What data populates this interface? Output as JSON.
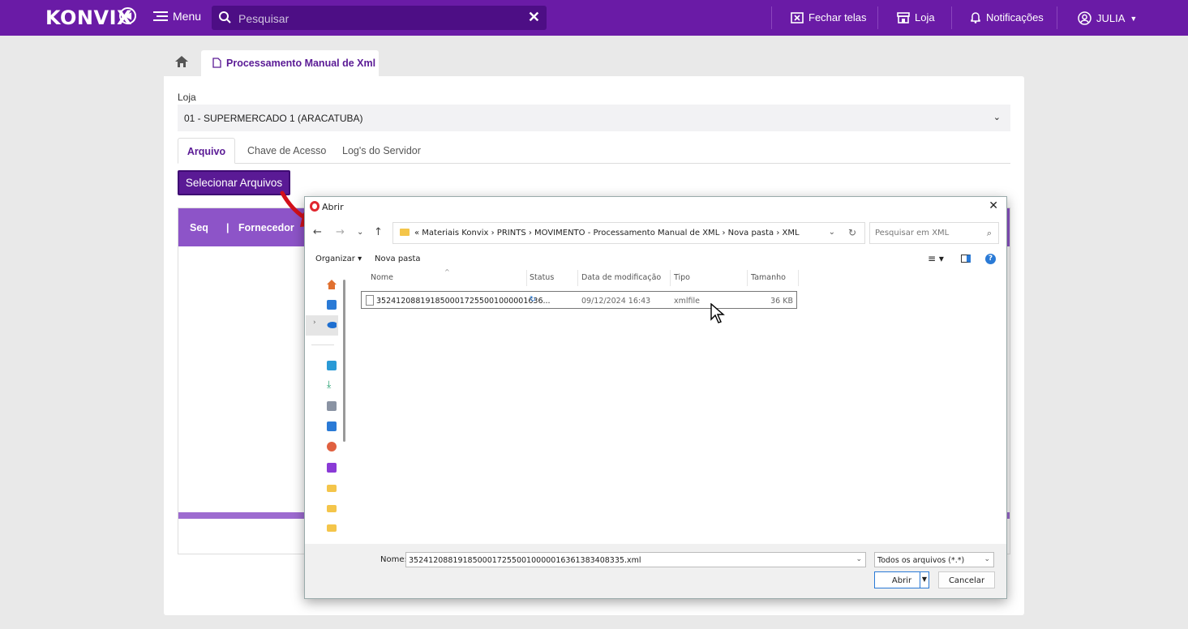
{
  "topbar": {
    "logo": "KONVIX",
    "menu_label": "Menu",
    "search_placeholder": "Pesquisar",
    "close_screens": "Fechar telas",
    "store": "Loja",
    "notifications": "Notificações",
    "user": "JULIA"
  },
  "page": {
    "tab_title": "Processamento Manual de Xml",
    "loja_label": "Loja",
    "loja_value": "01 - SUPERMERCADO 1 (ARACATUBA)",
    "tabs": [
      "Arquivo",
      "Chave de Acesso",
      "Log's do Servidor"
    ],
    "select_files_button": "Selecionar Arquivos",
    "grid_columns": [
      "Seq",
      "Fornecedor"
    ]
  },
  "dialog": {
    "title": "Abrir",
    "breadcrumb": "« Materiais Konvix › PRINTS › MOVIMENTO - Processamento Manual de XML › Nova pasta › XML",
    "search_placeholder": "Pesquisar em XML",
    "toolbar": {
      "organize": "Organizar ▾",
      "new_folder": "Nova pasta"
    },
    "columns": [
      "Nome",
      "Status",
      "Data de modificação",
      "Tipo",
      "Tamanho"
    ],
    "files": [
      {
        "name": "352412088191850001725500100000163​6...",
        "modified": "09/12/2024 16:43",
        "type": "xmlfile",
        "size": "36 KB"
      }
    ],
    "name_label": "Nome:",
    "name_value": "35241208819185000172550010000016361383408335.xml",
    "file_type": "Todos os arquivos (*.*)",
    "open_button": "Abrir",
    "cancel_button": "Cancelar"
  },
  "colors": {
    "brand": "#6a1ba6",
    "header_grid": "#8d54c8",
    "accent_blue": "#2a7ad6"
  }
}
